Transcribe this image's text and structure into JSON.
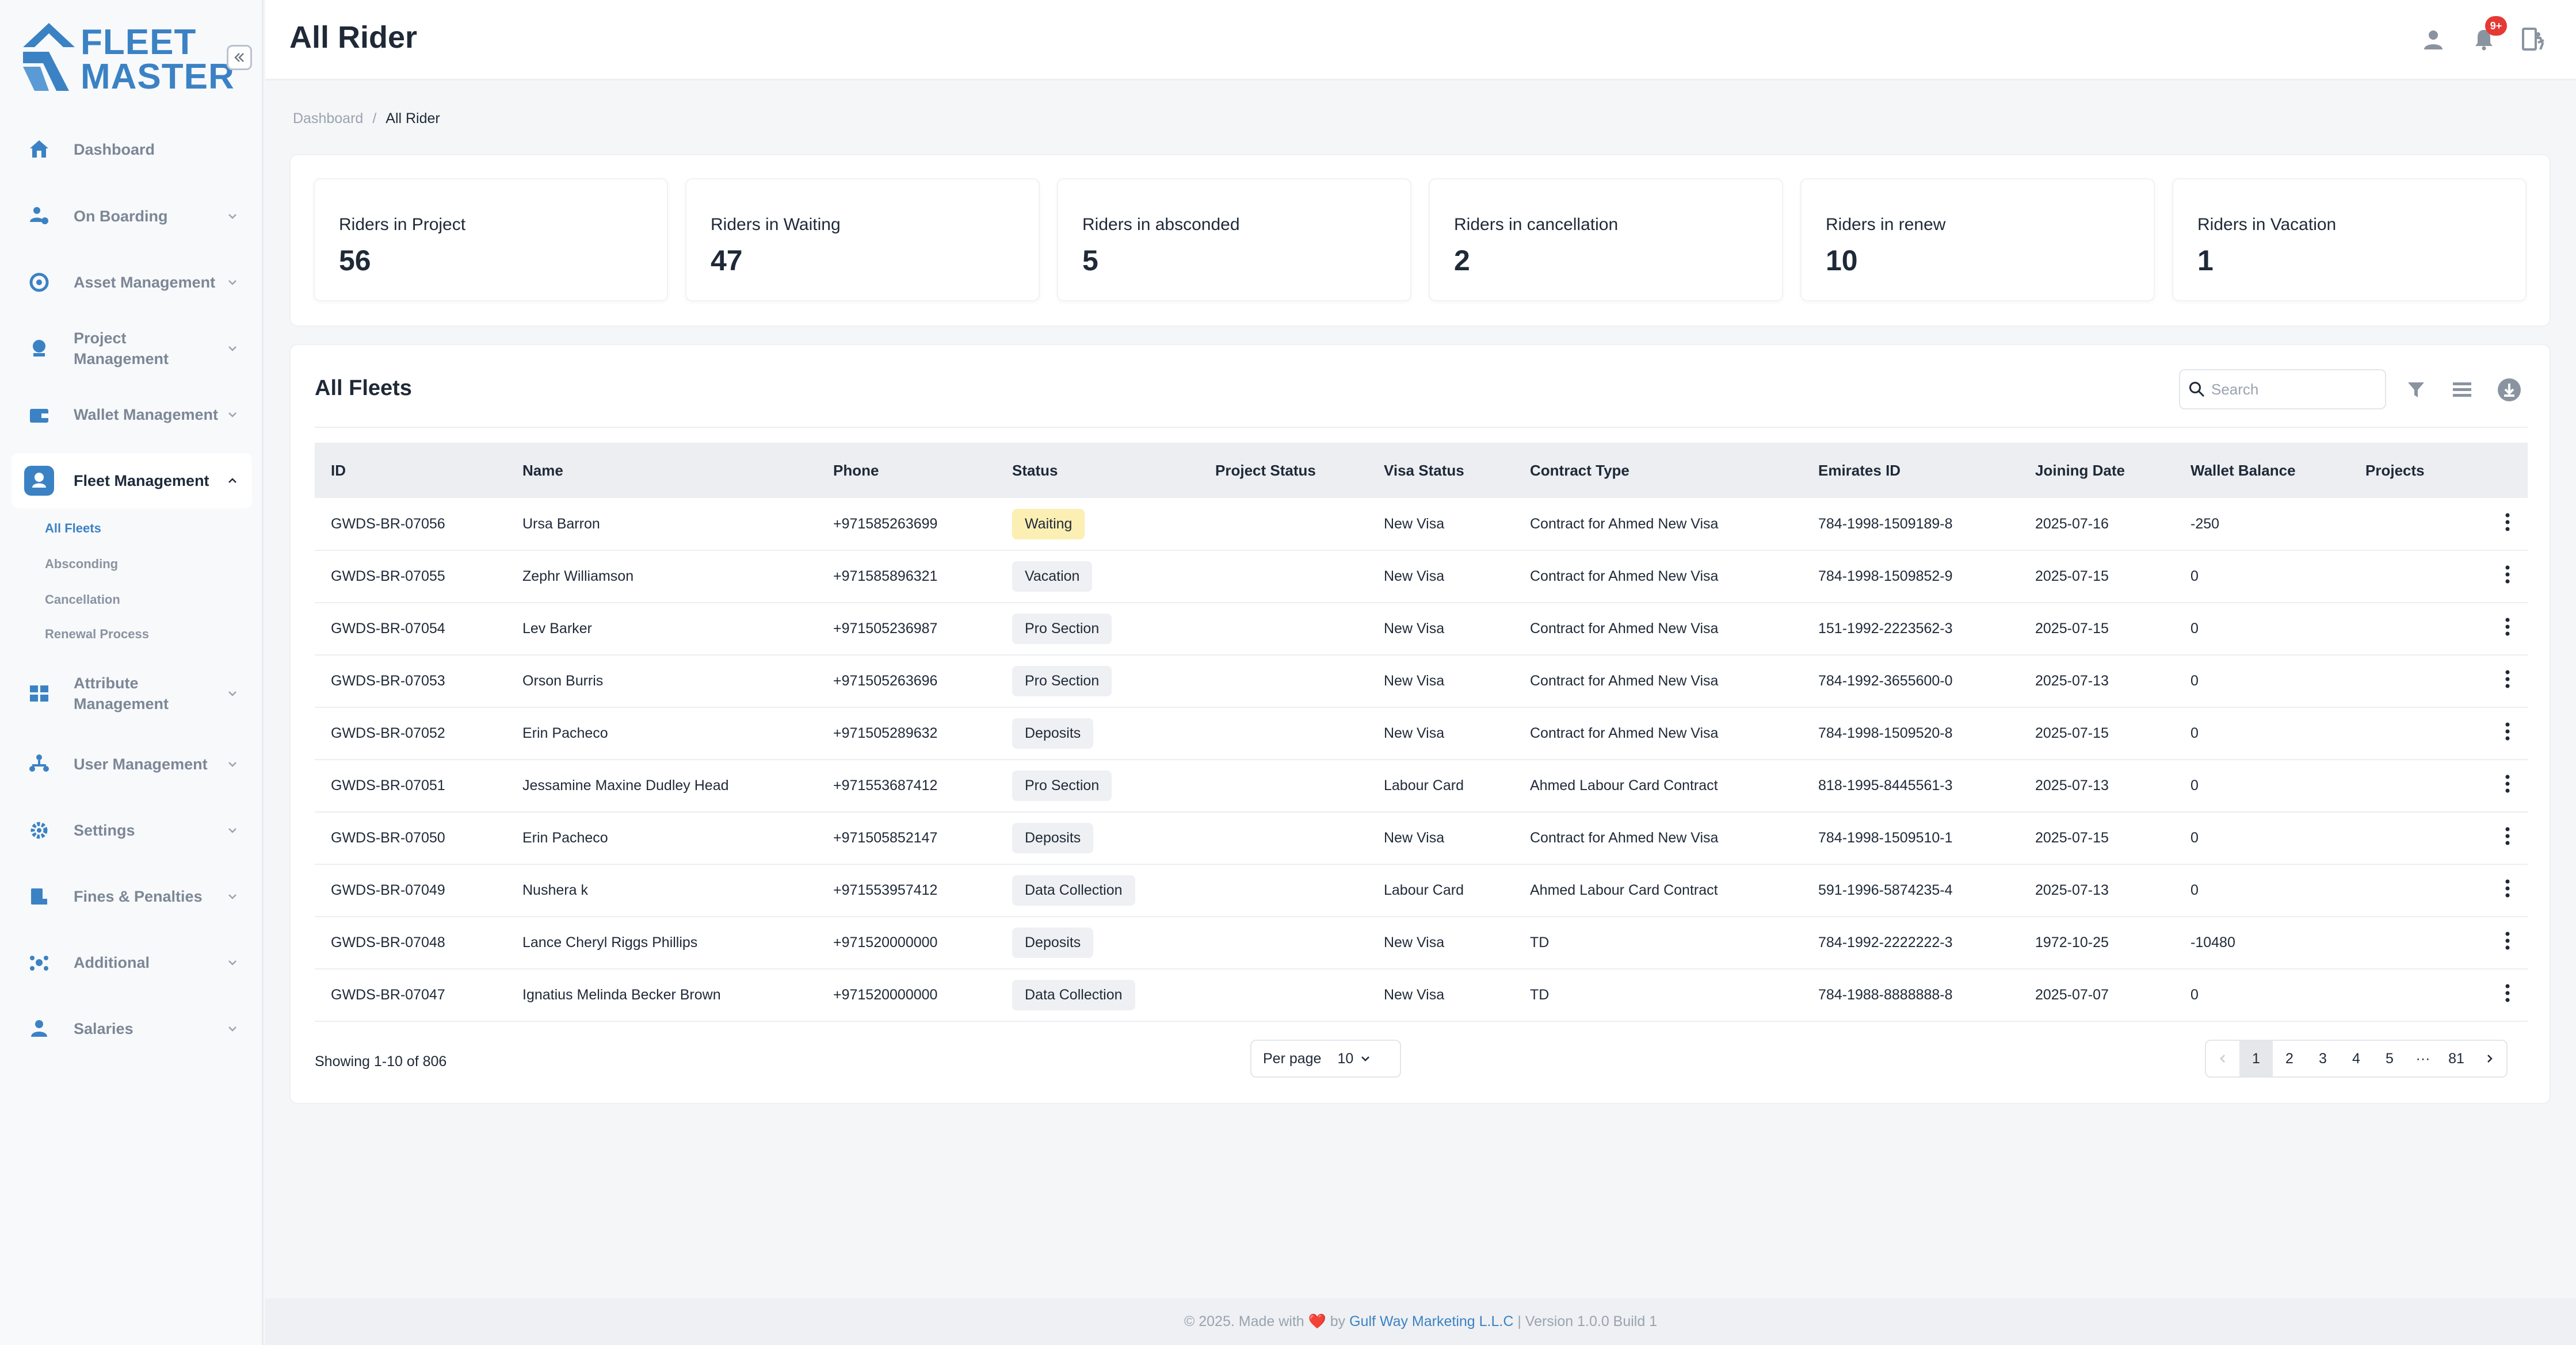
{
  "brand": {
    "line1": "FLEET",
    "line2": "MASTER"
  },
  "colors": {
    "accent": "#3b82c4",
    "badge": "#e53935",
    "waiting": "#fcefb4"
  },
  "sidebar": {
    "items": [
      {
        "label": "Dashboard",
        "icon": "home-icon"
      },
      {
        "label": "On Boarding",
        "icon": "onboarding-icon"
      },
      {
        "label": "Asset Management",
        "icon": "asset-icon"
      },
      {
        "label": "Project Management",
        "icon": "project-icon"
      },
      {
        "label": "Wallet Management",
        "icon": "wallet-icon"
      },
      {
        "label": "Fleet Management",
        "icon": "fleet-icon"
      },
      {
        "label": "Attribute Management",
        "icon": "attribute-icon"
      },
      {
        "label": "User Management",
        "icon": "users-icon"
      },
      {
        "label": "Settings",
        "icon": "gear-icon"
      },
      {
        "label": "Fines & Penalties",
        "icon": "fines-icon"
      },
      {
        "label": "Additional",
        "icon": "additional-icon"
      },
      {
        "label": "Salaries",
        "icon": "salaries-icon"
      }
    ],
    "fleet_sub": [
      "All Fleets",
      "Absconding",
      "Cancellation",
      "Renewal Process"
    ]
  },
  "header": {
    "title": "All Rider",
    "notifications": "9+"
  },
  "breadcrumb": {
    "root": "Dashboard",
    "sep": "/",
    "current": "All Rider"
  },
  "stats": [
    {
      "label": "Riders in Project",
      "value": "56"
    },
    {
      "label": "Riders in Waiting",
      "value": "47"
    },
    {
      "label": "Riders in absconded",
      "value": "5"
    },
    {
      "label": "Riders in cancellation",
      "value": "2"
    },
    {
      "label": "Riders in renew",
      "value": "10"
    },
    {
      "label": "Riders in Vacation",
      "value": "1"
    }
  ],
  "panel": {
    "title": "All Fleets",
    "search_placeholder": "Search"
  },
  "table": {
    "columns": [
      "ID",
      "Name",
      "Phone",
      "Status",
      "Project Status",
      "Visa Status",
      "Contract Type",
      "Emirates ID",
      "Joining Date",
      "Wallet Balance",
      "Projects"
    ],
    "rows": [
      [
        "GWDS-BR-07056",
        "Ursa Barron",
        "+971585263699",
        "Waiting",
        "",
        "New Visa",
        "Contract for Ahmed New Visa",
        "784-1998-1509189-8",
        "2025-07-16",
        "-250",
        ""
      ],
      [
        "GWDS-BR-07055",
        "Zephr Williamson",
        "+971585896321",
        "Vacation",
        "",
        "New Visa",
        "Contract for Ahmed New Visa",
        "784-1998-1509852-9",
        "2025-07-15",
        "0",
        ""
      ],
      [
        "GWDS-BR-07054",
        "Lev Barker",
        "+971505236987",
        "Pro Section",
        "",
        "New Visa",
        "Contract for Ahmed New Visa",
        "151-1992-2223562-3",
        "2025-07-15",
        "0",
        ""
      ],
      [
        "GWDS-BR-07053",
        "Orson Burris",
        "+971505263696",
        "Pro Section",
        "",
        "New Visa",
        "Contract for Ahmed New Visa",
        "784-1992-3655600-0",
        "2025-07-13",
        "0",
        ""
      ],
      [
        "GWDS-BR-07052",
        "Erin Pacheco",
        "+971505289632",
        "Deposits",
        "",
        "New Visa",
        "Contract for Ahmed New Visa",
        "784-1998-1509520-8",
        "2025-07-15",
        "0",
        ""
      ],
      [
        "GWDS-BR-07051",
        "Jessamine Maxine Dudley Head",
        "+971553687412",
        "Pro Section",
        "",
        "Labour Card",
        "Ahmed Labour Card Contract",
        "818-1995-8445561-3",
        "2025-07-13",
        "0",
        ""
      ],
      [
        "GWDS-BR-07050",
        "Erin Pacheco",
        "+971505852147",
        "Deposits",
        "",
        "New Visa",
        "Contract for Ahmed New Visa",
        "784-1998-1509510-1",
        "2025-07-15",
        "0",
        ""
      ],
      [
        "GWDS-BR-07049",
        "Nushera k",
        "+971553957412",
        "Data Collection",
        "",
        "Labour Card",
        "Ahmed Labour Card Contract",
        "591-1996-5874235-4",
        "2025-07-13",
        "0",
        ""
      ],
      [
        "GWDS-BR-07048",
        "Lance Cheryl Riggs Phillips",
        "+971520000000",
        "Deposits",
        "",
        "New Visa",
        "TD",
        "784-1992-2222222-3",
        "1972-10-25",
        "-10480",
        ""
      ],
      [
        "GWDS-BR-07047",
        "Ignatius Melinda Becker Brown",
        "+971520000000",
        "Data Collection",
        "",
        "New Visa",
        "TD",
        "784-1988-8888888-8",
        "2025-07-07",
        "0",
        ""
      ]
    ]
  },
  "pagination": {
    "showing": "Showing 1-10 of 806",
    "per_page_label": "Per page",
    "per_page_value": "10",
    "pages": [
      "1",
      "2",
      "3",
      "4",
      "5",
      "···",
      "81"
    ],
    "current": "1"
  },
  "footer": {
    "prefix": "© 2025. Made with",
    "heart": "❤️",
    "by": "by",
    "company": "Gulf Way Marketing L.L.C",
    "version": "| Version 1.0.0 Build 1"
  }
}
